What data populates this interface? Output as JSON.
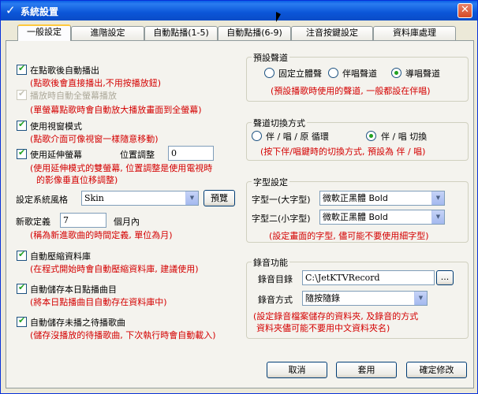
{
  "window": {
    "title": "系統設置",
    "app_icon": "checkmark-icon",
    "close_icon": "close-icon"
  },
  "tabs": [
    {
      "label": "一般設定",
      "active": true
    },
    {
      "label": "進階設定",
      "active": false
    },
    {
      "label": "自動點播(1-5)",
      "active": false
    },
    {
      "label": "自動點播(6-9)",
      "active": false
    },
    {
      "label": "注音按鍵設定",
      "active": false
    },
    {
      "label": "資料庫處理",
      "active": false
    }
  ],
  "left": {
    "auto_play": {
      "label": "在點歌後自動播出",
      "checked": true,
      "hint": "(點歌後會直接播出,不用按播放鈕)"
    },
    "fullscreen": {
      "label": "播放時自動全螢幕播放",
      "checked": true,
      "disabled": true,
      "hint": "(單螢幕點歌時會自動放大播放畫面到全螢幕)"
    },
    "window_mode": {
      "label": "使用視窗模式",
      "checked": true,
      "hint": "(點歌介面可像視窗一樣隨意移動)"
    },
    "extend_screen": {
      "label": "使用延伸螢幕",
      "checked": true,
      "position_label": "位置調整",
      "position_value": "0",
      "hint_line1": "(使用延伸模式的雙螢幕, 位置調整是使用電視時",
      "hint_line2": "的影像垂直位移調整)"
    },
    "skin": {
      "label": "設定系統風格",
      "value": "Skin",
      "preview_label": "預覽"
    },
    "new_song": {
      "label": "新歌定義",
      "value": "7",
      "unit": "個月內",
      "hint": "(稱為新進歌曲的時間定義, 單位為月)"
    },
    "compress_db": {
      "label": "自動壓縮資料庫",
      "checked": true,
      "hint": "(在程式開始時會自動壓縮資料庫, 建議使用)"
    },
    "save_today": {
      "label": "自動儲存本日點播曲目",
      "checked": true,
      "hint": "(將本日點播曲目自動存在資料庫中)"
    },
    "save_unplayed": {
      "label": "自動儲存未播之待播歌曲",
      "checked": true,
      "hint": "(儲存沒播放的待播歌曲, 下次執行時會自動載入)"
    }
  },
  "preset_channel": {
    "title": "預設聲道",
    "options": [
      "固定立體聲",
      "伴唱聲道",
      "導唱聲道"
    ],
    "selected": 2,
    "hint": "(預設播歌時使用的聲道, 一般都設在伴唱)"
  },
  "channel_switch": {
    "title": "聲道切換方式",
    "options": [
      "伴 / 唱 / 原 循環",
      "伴 / 唱 切換"
    ],
    "selected": 1,
    "hint": "(按下伴/唱鍵時的切換方式, 預設為 伴 / 唱)"
  },
  "font_settings": {
    "title": "字型設定",
    "font1_label": "字型一(大字型)",
    "font1_value": "微軟正黑體 Bold",
    "font2_label": "字型二(小字型)",
    "font2_value": "微軟正黑體 Bold",
    "hint": "(設定畫面的字型, 儘可能不要使用細字型)"
  },
  "recording": {
    "title": "錄音功能",
    "dir_label": "錄音目錄",
    "dir_value": "C:\\JetKTVRecord",
    "browse_label": "...",
    "mode_label": "錄音方式",
    "mode_value": "隨按隨錄",
    "hint_line1": "(設定錄音檔案儲存的資料夾, 及錄音的方式",
    "hint_line2": "資料夾儘可能不要用中文資料夾名)"
  },
  "footer": {
    "cancel": "取消",
    "apply": "套用",
    "ok": "確定修改"
  }
}
